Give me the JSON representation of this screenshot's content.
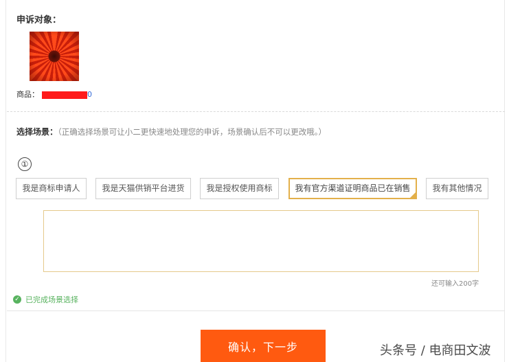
{
  "complaint_target": {
    "title": "申诉对象：",
    "product_label": "商品：",
    "product_tail": "0"
  },
  "scene": {
    "title": "选择场景：",
    "hint": "（正确选择场景可让小二更快速地处理您的申诉，场景确认后不可以更改哦。）",
    "step_marker": "①",
    "options": [
      {
        "label": "我是商标申请人",
        "selected": false
      },
      {
        "label": "我是天猫供销平台进货",
        "selected": false
      },
      {
        "label": "我是授权使用商标",
        "selected": false
      },
      {
        "label": "我有官方渠道证明商品已在销售",
        "selected": true
      },
      {
        "label": "我有其他情况",
        "selected": false
      }
    ],
    "details_value": "",
    "char_counter": "还可输入200字",
    "status_text": "已完成场景选择"
  },
  "actions": {
    "confirm_label": "确认，下一步"
  },
  "watermark": "头条号 / 电商田文波",
  "colors": {
    "accent": "#ff5a10",
    "selected_border": "#e3b04a",
    "success": "#58b35f",
    "redaction": "#ff1a1a"
  }
}
